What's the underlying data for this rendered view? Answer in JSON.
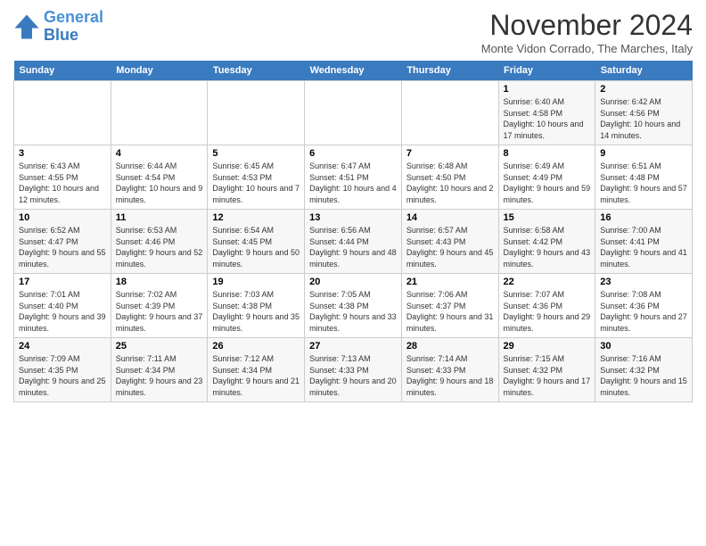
{
  "logo": {
    "line1": "General",
    "line2": "Blue"
  },
  "title": "November 2024",
  "location": "Monte Vidon Corrado, The Marches, Italy",
  "weekdays": [
    "Sunday",
    "Monday",
    "Tuesday",
    "Wednesday",
    "Thursday",
    "Friday",
    "Saturday"
  ],
  "weeks": [
    [
      {
        "day": "",
        "detail": ""
      },
      {
        "day": "",
        "detail": ""
      },
      {
        "day": "",
        "detail": ""
      },
      {
        "day": "",
        "detail": ""
      },
      {
        "day": "",
        "detail": ""
      },
      {
        "day": "1",
        "detail": "Sunrise: 6:40 AM\nSunset: 4:58 PM\nDaylight: 10 hours and 17 minutes."
      },
      {
        "day": "2",
        "detail": "Sunrise: 6:42 AM\nSunset: 4:56 PM\nDaylight: 10 hours and 14 minutes."
      }
    ],
    [
      {
        "day": "3",
        "detail": "Sunrise: 6:43 AM\nSunset: 4:55 PM\nDaylight: 10 hours and 12 minutes."
      },
      {
        "day": "4",
        "detail": "Sunrise: 6:44 AM\nSunset: 4:54 PM\nDaylight: 10 hours and 9 minutes."
      },
      {
        "day": "5",
        "detail": "Sunrise: 6:45 AM\nSunset: 4:53 PM\nDaylight: 10 hours and 7 minutes."
      },
      {
        "day": "6",
        "detail": "Sunrise: 6:47 AM\nSunset: 4:51 PM\nDaylight: 10 hours and 4 minutes."
      },
      {
        "day": "7",
        "detail": "Sunrise: 6:48 AM\nSunset: 4:50 PM\nDaylight: 10 hours and 2 minutes."
      },
      {
        "day": "8",
        "detail": "Sunrise: 6:49 AM\nSunset: 4:49 PM\nDaylight: 9 hours and 59 minutes."
      },
      {
        "day": "9",
        "detail": "Sunrise: 6:51 AM\nSunset: 4:48 PM\nDaylight: 9 hours and 57 minutes."
      }
    ],
    [
      {
        "day": "10",
        "detail": "Sunrise: 6:52 AM\nSunset: 4:47 PM\nDaylight: 9 hours and 55 minutes."
      },
      {
        "day": "11",
        "detail": "Sunrise: 6:53 AM\nSunset: 4:46 PM\nDaylight: 9 hours and 52 minutes."
      },
      {
        "day": "12",
        "detail": "Sunrise: 6:54 AM\nSunset: 4:45 PM\nDaylight: 9 hours and 50 minutes."
      },
      {
        "day": "13",
        "detail": "Sunrise: 6:56 AM\nSunset: 4:44 PM\nDaylight: 9 hours and 48 minutes."
      },
      {
        "day": "14",
        "detail": "Sunrise: 6:57 AM\nSunset: 4:43 PM\nDaylight: 9 hours and 45 minutes."
      },
      {
        "day": "15",
        "detail": "Sunrise: 6:58 AM\nSunset: 4:42 PM\nDaylight: 9 hours and 43 minutes."
      },
      {
        "day": "16",
        "detail": "Sunrise: 7:00 AM\nSunset: 4:41 PM\nDaylight: 9 hours and 41 minutes."
      }
    ],
    [
      {
        "day": "17",
        "detail": "Sunrise: 7:01 AM\nSunset: 4:40 PM\nDaylight: 9 hours and 39 minutes."
      },
      {
        "day": "18",
        "detail": "Sunrise: 7:02 AM\nSunset: 4:39 PM\nDaylight: 9 hours and 37 minutes."
      },
      {
        "day": "19",
        "detail": "Sunrise: 7:03 AM\nSunset: 4:38 PM\nDaylight: 9 hours and 35 minutes."
      },
      {
        "day": "20",
        "detail": "Sunrise: 7:05 AM\nSunset: 4:38 PM\nDaylight: 9 hours and 33 minutes."
      },
      {
        "day": "21",
        "detail": "Sunrise: 7:06 AM\nSunset: 4:37 PM\nDaylight: 9 hours and 31 minutes."
      },
      {
        "day": "22",
        "detail": "Sunrise: 7:07 AM\nSunset: 4:36 PM\nDaylight: 9 hours and 29 minutes."
      },
      {
        "day": "23",
        "detail": "Sunrise: 7:08 AM\nSunset: 4:36 PM\nDaylight: 9 hours and 27 minutes."
      }
    ],
    [
      {
        "day": "24",
        "detail": "Sunrise: 7:09 AM\nSunset: 4:35 PM\nDaylight: 9 hours and 25 minutes."
      },
      {
        "day": "25",
        "detail": "Sunrise: 7:11 AM\nSunset: 4:34 PM\nDaylight: 9 hours and 23 minutes."
      },
      {
        "day": "26",
        "detail": "Sunrise: 7:12 AM\nSunset: 4:34 PM\nDaylight: 9 hours and 21 minutes."
      },
      {
        "day": "27",
        "detail": "Sunrise: 7:13 AM\nSunset: 4:33 PM\nDaylight: 9 hours and 20 minutes."
      },
      {
        "day": "28",
        "detail": "Sunrise: 7:14 AM\nSunset: 4:33 PM\nDaylight: 9 hours and 18 minutes."
      },
      {
        "day": "29",
        "detail": "Sunrise: 7:15 AM\nSunset: 4:32 PM\nDaylight: 9 hours and 17 minutes."
      },
      {
        "day": "30",
        "detail": "Sunrise: 7:16 AM\nSunset: 4:32 PM\nDaylight: 9 hours and 15 minutes."
      }
    ]
  ]
}
